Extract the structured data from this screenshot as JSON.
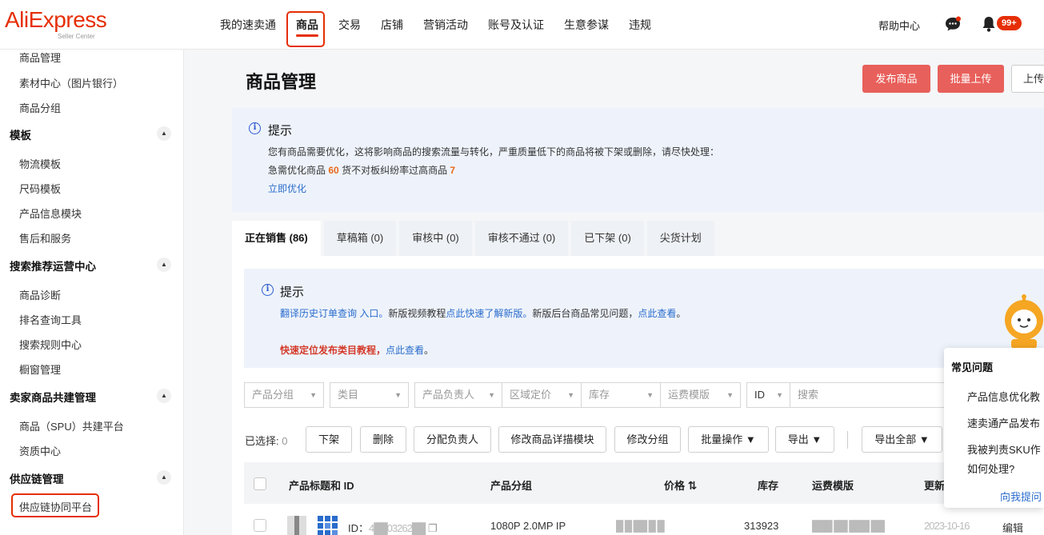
{
  "logo": {
    "brand": "AliExpress",
    "sub": "Seller Center"
  },
  "topnav": [
    "我的速卖通",
    "商品",
    "交易",
    "店铺",
    "营销活动",
    "账号及认证",
    "生意参谋",
    "违规"
  ],
  "header": {
    "help": "帮助中心",
    "notification_badge": "99+"
  },
  "sidebar": {
    "items_top": [
      "商品管理",
      "素材中心（图片银行）",
      "商品分组"
    ],
    "groups": [
      {
        "title": "模板",
        "items": [
          "物流模板",
          "尺码模板",
          "产品信息模块",
          "售后和服务"
        ]
      },
      {
        "title": "搜索推荐运营中心",
        "items": [
          "商品诊断",
          "排名查询工具",
          "搜索规则中心",
          "橱窗管理"
        ]
      },
      {
        "title": "卖家商品共建管理",
        "items": [
          "商品（SPU）共建平台",
          "资质中心"
        ]
      },
      {
        "title": "供应链管理",
        "items": [
          "供应链协同平台"
        ]
      }
    ]
  },
  "page": {
    "title": "商品管理",
    "btn_publish": "发布商品",
    "btn_bulk_upload": "批量上传",
    "btn_upload": "上传"
  },
  "notice": {
    "title": "提示",
    "line1": "您有商品需要优化，这将影响商品的搜索流量与转化，严重质量低下的商品将被下架或删除，请尽快处理：",
    "line2_a": "急需优化商品",
    "line2_n1": "60",
    "line2_b": "货不对板纠纷率过高商品",
    "line2_n2": "7",
    "link": "立即优化"
  },
  "tabs": [
    "正在销售 (86)",
    "草稿箱 (0)",
    "审核中 (0)",
    "审核不通过 (0)",
    "已下架 (0)",
    "尖货计划"
  ],
  "inner_notice": {
    "title": "提示",
    "l1_a": "翻译历史订单查询 入口。",
    "l1_b": "新版视频教程",
    "l1_c": "点此快速了解新版。",
    "l1_d": "新版后台商品常见问题，",
    "l1_e": "点此查看",
    "l1_f": "。",
    "l2_a": "快速定位发布类目教程，",
    "l2_b": "点此查看",
    "l2_c": "。"
  },
  "filters": {
    "group": "产品分组",
    "category": "类目",
    "owner": "产品负责人",
    "region_price": "区域定价",
    "stock": "库存",
    "shipping": "运费模版",
    "id": "ID",
    "search_placeholder": "搜索"
  },
  "actions": {
    "selected_label": "已选择:",
    "selected_count": "0",
    "delist": "下架",
    "delete": "删除",
    "assign": "分配负责人",
    "edit_detail": "修改商品详描模块",
    "edit_group": "修改分组",
    "bulk": "批量操作 ▼",
    "export": "导出 ▼",
    "export_all": "导出全部 ▼"
  },
  "table": {
    "headers": [
      "产品标题和 ID",
      "产品分组",
      "价格",
      "库存",
      "运费模版",
      "更新"
    ],
    "row1": {
      "id_label": "ID：",
      "id_value": "4██03262██",
      "group": "1080P 2.0MP IP",
      "price": "█ █ ██ █ █",
      "stock": "313923",
      "shipping": "███ ██ ███ ██",
      "updated": "2023-10-16",
      "edit": "编辑"
    }
  },
  "faq": {
    "title": "常见问题",
    "items": [
      "产品信息优化教",
      "速卖通产品发布",
      "我被判责SKU作",
      "如何处理?"
    ],
    "ask": "向我提问"
  }
}
